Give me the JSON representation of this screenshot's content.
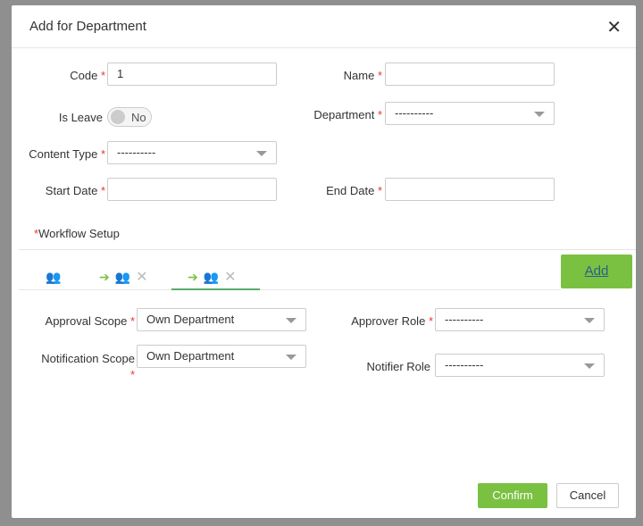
{
  "dialog": {
    "title": "Add for Department"
  },
  "fields": {
    "code_label": "Code",
    "code_value": "1",
    "name_label": "Name",
    "name_value": "",
    "is_leave_label": "Is Leave",
    "is_leave_value": "No",
    "department_label": "Department",
    "department_value": "----------",
    "content_type_label": "Content Type",
    "content_type_value": "----------",
    "start_date_label": "Start Date",
    "start_date_value": "",
    "end_date_label": "End Date",
    "end_date_value": ""
  },
  "workflow": {
    "label": "Workflow Setup",
    "add_label": "Add",
    "approval_scope_label": "Approval Scope",
    "approval_scope_value": "Own Department",
    "approver_role_label": "Approver Role",
    "approver_role_value": "----------",
    "notification_scope_label": "Notification Scope",
    "notification_scope_value": "Own Department",
    "notifier_role_label": "Notifier Role",
    "notifier_role_value": "----------"
  },
  "footer": {
    "confirm": "Confirm",
    "cancel": "Cancel"
  },
  "colors": {
    "accent": "#7ac142",
    "tab_underline": "#5aab6e"
  }
}
